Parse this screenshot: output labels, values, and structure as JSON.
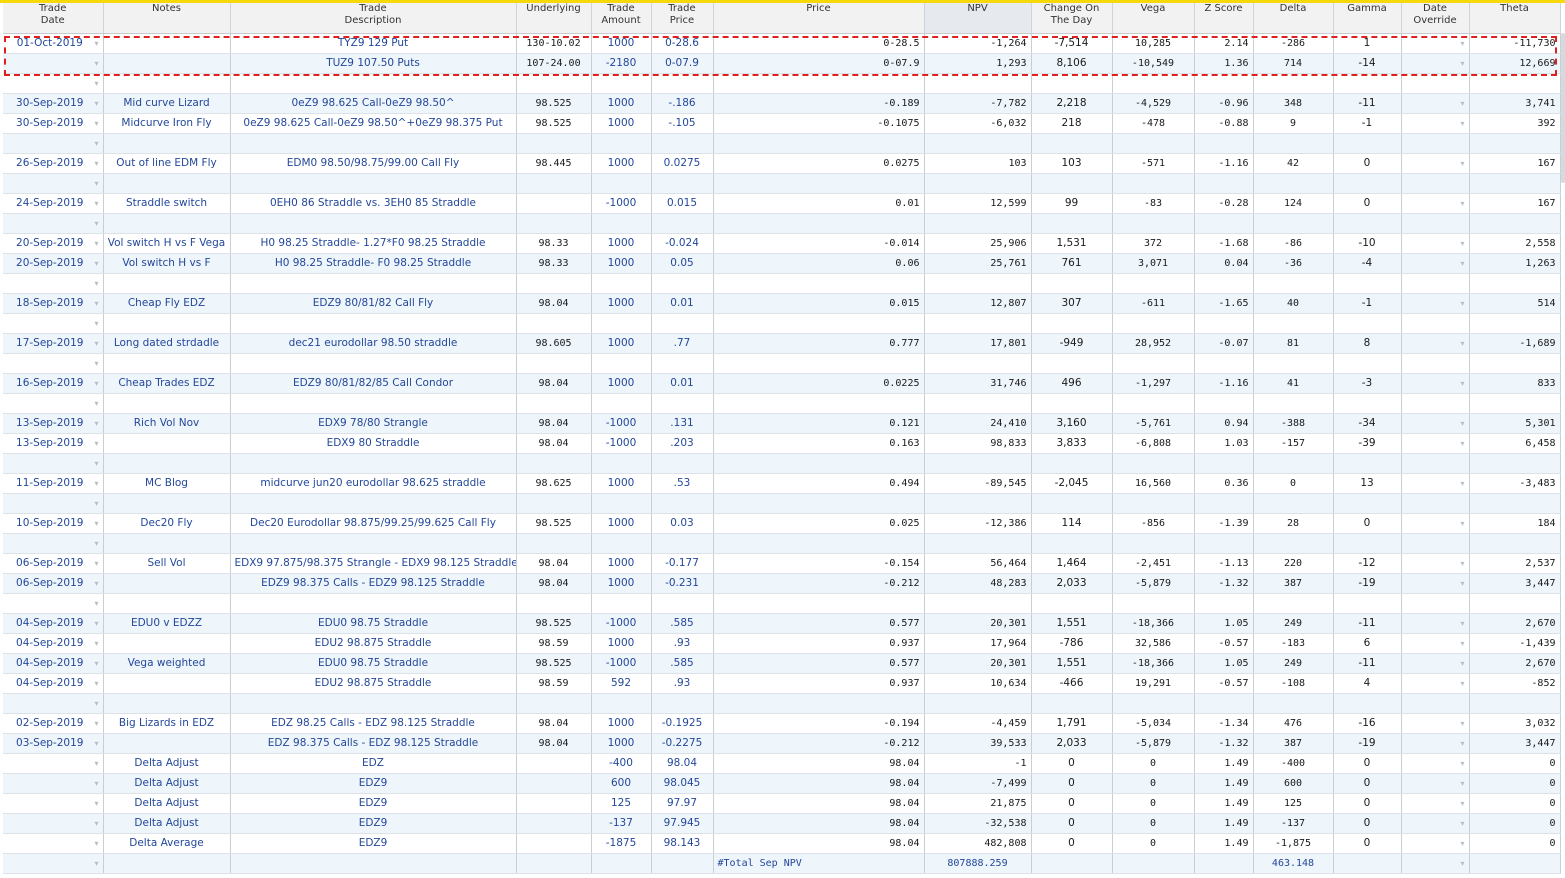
{
  "columns": [
    {
      "key": "trade_date",
      "label": "Trade\nDate"
    },
    {
      "key": "notes",
      "label": "Notes"
    },
    {
      "key": "description",
      "label": "Trade\nDescription"
    },
    {
      "key": "underlying",
      "label": "Underlying"
    },
    {
      "key": "amount",
      "label": "Trade\nAmount"
    },
    {
      "key": "trade_price",
      "label": "Trade\nPrice"
    },
    {
      "key": "price",
      "label": "Price"
    },
    {
      "key": "npv",
      "label": "NPV"
    },
    {
      "key": "change",
      "label": "Change On\nThe Day"
    },
    {
      "key": "vega",
      "label": "Vega"
    },
    {
      "key": "zscore",
      "label": "Z Score"
    },
    {
      "key": "delta",
      "label": "Delta"
    },
    {
      "key": "gamma",
      "label": "Gamma"
    },
    {
      "key": "date_override",
      "label": "Date\nOverride"
    },
    {
      "key": "theta",
      "label": "Theta"
    }
  ],
  "rows": [
    {
      "trade_date": "01-Oct-2019",
      "notes": "",
      "description": "TYZ9 129 Put",
      "underlying": "130-10.02",
      "amount": "1000",
      "trade_price": "0-28.6",
      "price": "0-28.5",
      "npv": "-1,264",
      "change": "-7,514",
      "vega": "10,285",
      "zscore": "2.14",
      "delta": "-286",
      "gamma": "1",
      "date_override": "",
      "theta": "-11,730",
      "style": "highlight"
    },
    {
      "trade_date": "",
      "notes": "",
      "description": "TUZ9 107.50 Puts",
      "underlying": "107-24.00",
      "amount": "-2180",
      "trade_price": "0-07.9",
      "price": "0-07.9",
      "npv": "1,293",
      "change": "8,106",
      "vega": "-10,549",
      "zscore": "1.36",
      "delta": "714",
      "gamma": "-14",
      "date_override": "",
      "theta": "12,669",
      "style": "highlight"
    },
    {
      "spacer": true
    },
    {
      "trade_date": "30-Sep-2019",
      "notes": "Mid curve Lizard",
      "description": "0eZ9 98.625 Call-0eZ9 98.50^",
      "underlying": "98.525",
      "amount": "1000",
      "trade_price": "-.186",
      "price": "-0.189",
      "npv": "-7,782",
      "change": "2,218",
      "vega": "-4,529",
      "zscore": "-0.96",
      "delta": "348",
      "gamma": "-11",
      "date_override": "",
      "theta": "3,741"
    },
    {
      "trade_date": "30-Sep-2019",
      "notes": "Midcurve Iron Fly",
      "description": "0eZ9 98.625 Call-0eZ9 98.50^+0eZ9 98.375 Put",
      "underlying": "98.525",
      "amount": "1000",
      "trade_price": "-.105",
      "price": "-0.1075",
      "npv": "-6,032",
      "change": "218",
      "vega": "-478",
      "zscore": "-0.88",
      "delta": "9",
      "gamma": "-1",
      "date_override": "",
      "theta": "392"
    },
    {
      "spacer": true
    },
    {
      "trade_date": "26-Sep-2019",
      "notes": "Out of line EDM Fly",
      "description": "EDM0 98.50/98.75/99.00 Call Fly",
      "underlying": "98.445",
      "amount": "1000",
      "trade_price": "0.0275",
      "price": "0.0275",
      "npv": "103",
      "change": "103",
      "vega": "-571",
      "zscore": "-1.16",
      "delta": "42",
      "gamma": "0",
      "date_override": "",
      "theta": "167"
    },
    {
      "spacer": true
    },
    {
      "trade_date": "24-Sep-2019",
      "notes": "Straddle switch",
      "description": "0EH0 86 Straddle vs. 3EH0 85 Straddle",
      "underlying": "",
      "amount": "-1000",
      "trade_price": "0.015",
      "price": "0.01",
      "npv": "12,599",
      "change": "99",
      "vega": "-83",
      "zscore": "-0.28",
      "delta": "124",
      "gamma": "0",
      "date_override": "",
      "theta": "167"
    },
    {
      "spacer": true
    },
    {
      "trade_date": "20-Sep-2019",
      "notes": "Vol switch H vs F Vega",
      "description": "H0 98.25 Straddle- 1.27*F0 98.25 Straddle",
      "underlying": "98.33",
      "amount": "1000",
      "trade_price": "-0.024",
      "price": "-0.014",
      "npv": "25,906",
      "change": "1,531",
      "vega": "372",
      "zscore": "-1.68",
      "delta": "-86",
      "gamma": "-10",
      "date_override": "",
      "theta": "2,558"
    },
    {
      "trade_date": "20-Sep-2019",
      "notes": "Vol switch H vs F",
      "description": "H0 98.25 Straddle- F0 98.25 Straddle",
      "underlying": "98.33",
      "amount": "1000",
      "trade_price": "0.05",
      "price": "0.06",
      "npv": "25,761",
      "change": "761",
      "vega": "3,071",
      "zscore": "0.04",
      "delta": "-36",
      "gamma": "-4",
      "date_override": "",
      "theta": "1,263"
    },
    {
      "spacer": true
    },
    {
      "trade_date": "18-Sep-2019",
      "notes": "Cheap Fly EDZ",
      "description": "EDZ9 80/81/82 Call Fly",
      "underlying": "98.04",
      "amount": "1000",
      "trade_price": "0.01",
      "price": "0.015",
      "npv": "12,807",
      "change": "307",
      "vega": "-611",
      "zscore": "-1.65",
      "delta": "40",
      "gamma": "-1",
      "date_override": "",
      "theta": "514"
    },
    {
      "spacer": true
    },
    {
      "trade_date": "17-Sep-2019",
      "notes": "Long dated strdadle",
      "description": "dec21 eurodollar 98.50 straddle",
      "underlying": "98.605",
      "amount": "1000",
      "trade_price": ".77",
      "price": "0.777",
      "npv": "17,801",
      "change": "-949",
      "vega": "28,952",
      "zscore": "-0.07",
      "delta": "81",
      "gamma": "8",
      "date_override": "",
      "theta": "-1,689"
    },
    {
      "spacer": true
    },
    {
      "trade_date": "16-Sep-2019",
      "notes": "Cheap Trades EDZ",
      "description": "EDZ9 80/81/82/85 Call Condor",
      "underlying": "98.04",
      "amount": "1000",
      "trade_price": "0.01",
      "price": "0.0225",
      "npv": "31,746",
      "change": "496",
      "vega": "-1,297",
      "zscore": "-1.16",
      "delta": "41",
      "gamma": "-3",
      "date_override": "",
      "theta": "833"
    },
    {
      "spacer": true
    },
    {
      "trade_date": "13-Sep-2019",
      "notes": "Rich Vol Nov",
      "description": "EDX9 78/80 Strangle",
      "underlying": "98.04",
      "amount": "-1000",
      "trade_price": ".131",
      "price": "0.121",
      "npv": "24,410",
      "change": "3,160",
      "vega": "-5,761",
      "zscore": "0.94",
      "delta": "-388",
      "gamma": "-34",
      "date_override": "",
      "theta": "5,301"
    },
    {
      "trade_date": "13-Sep-2019",
      "notes": "",
      "description": "EDX9 80 Straddle",
      "underlying": "98.04",
      "amount": "-1000",
      "trade_price": ".203",
      "price": "0.163",
      "npv": "98,833",
      "change": "3,833",
      "vega": "-6,808",
      "zscore": "1.03",
      "delta": "-157",
      "gamma": "-39",
      "date_override": "",
      "theta": "6,458"
    },
    {
      "spacer": true
    },
    {
      "trade_date": "11-Sep-2019",
      "notes": "MC Blog",
      "description": "midcurve jun20 eurodollar 98.625 straddle",
      "underlying": "98.625",
      "amount": "1000",
      "trade_price": ".53",
      "price": "0.494",
      "npv": "-89,545",
      "change": "-2,045",
      "vega": "16,560",
      "zscore": "0.36",
      "delta": "0",
      "gamma": "13",
      "date_override": "",
      "theta": "-3,483"
    },
    {
      "spacer": true
    },
    {
      "trade_date": "10-Sep-2019",
      "notes": "Dec20 Fly",
      "description": "Dec20 Eurodollar 98.875/99.25/99.625 Call Fly",
      "underlying": "98.525",
      "amount": "1000",
      "trade_price": "0.03",
      "price": "0.025",
      "npv": "-12,386",
      "change": "114",
      "vega": "-856",
      "zscore": "-1.39",
      "delta": "28",
      "gamma": "0",
      "date_override": "",
      "theta": "184"
    },
    {
      "spacer": true
    },
    {
      "trade_date": "06-Sep-2019",
      "notes": "Sell Vol",
      "description": "EDX9 97.875/98.375 Strangle - EDX9 98.125 Straddle",
      "underlying": "98.04",
      "amount": "1000",
      "trade_price": "-0.177",
      "price": "-0.154",
      "npv": "56,464",
      "change": "1,464",
      "vega": "-2,451",
      "zscore": "-1.13",
      "delta": "220",
      "gamma": "-12",
      "date_override": "",
      "theta": "2,537"
    },
    {
      "trade_date": "06-Sep-2019",
      "notes": "",
      "description": "EDZ9 98.375 Calls - EDZ9 98.125 Straddle",
      "underlying": "98.04",
      "amount": "1000",
      "trade_price": "-0.231",
      "price": "-0.212",
      "npv": "48,283",
      "change": "2,033",
      "vega": "-5,879",
      "zscore": "-1.32",
      "delta": "387",
      "gamma": "-19",
      "date_override": "",
      "theta": "3,447"
    },
    {
      "spacer": true
    },
    {
      "trade_date": "04-Sep-2019",
      "notes": "EDU0 v EDZZ",
      "description": "EDU0 98.75 Straddle",
      "underlying": "98.525",
      "amount": "-1000",
      "trade_price": ".585",
      "price": "0.577",
      "npv": "20,301",
      "change": "1,551",
      "vega": "-18,366",
      "zscore": "1.05",
      "delta": "249",
      "gamma": "-11",
      "date_override": "",
      "theta": "2,670"
    },
    {
      "trade_date": "04-Sep-2019",
      "notes": "",
      "description": "EDU2 98.875 Straddle",
      "underlying": "98.59",
      "amount": "1000",
      "trade_price": ".93",
      "price": "0.937",
      "npv": "17,964",
      "change": "-786",
      "vega": "32,586",
      "zscore": "-0.57",
      "delta": "-183",
      "gamma": "6",
      "date_override": "",
      "theta": "-1,439"
    },
    {
      "trade_date": "04-Sep-2019",
      "notes": "Vega weighted",
      "description": "EDU0 98.75 Straddle",
      "underlying": "98.525",
      "amount": "-1000",
      "trade_price": ".585",
      "price": "0.577",
      "npv": "20,301",
      "change": "1,551",
      "vega": "-18,366",
      "zscore": "1.05",
      "delta": "249",
      "gamma": "-11",
      "date_override": "",
      "theta": "2,670"
    },
    {
      "trade_date": "04-Sep-2019",
      "notes": "",
      "description": "EDU2 98.875 Straddle",
      "underlying": "98.59",
      "amount": "592",
      "trade_price": ".93",
      "price": "0.937",
      "npv": "10,634",
      "change": "-466",
      "vega": "19,291",
      "zscore": "-0.57",
      "delta": "-108",
      "gamma": "4",
      "date_override": "",
      "theta": "-852"
    },
    {
      "spacer": true
    },
    {
      "trade_date": "02-Sep-2019",
      "notes": "Big Lizards in EDZ",
      "description": "EDZ 98.25 Calls - EDZ 98.125 Straddle",
      "underlying": "98.04",
      "amount": "1000",
      "trade_price": "-0.1925",
      "price": "-0.194",
      "npv": "-4,459",
      "change": "1,791",
      "vega": "-5,034",
      "zscore": "-1.34",
      "delta": "476",
      "gamma": "-16",
      "date_override": "",
      "theta": "3,032"
    },
    {
      "trade_date": "03-Sep-2019",
      "notes": "",
      "description": "EDZ 98.375 Calls - EDZ 98.125 Straddle",
      "underlying": "98.04",
      "amount": "1000",
      "trade_price": "-0.2275",
      "price": "-0.212",
      "npv": "39,533",
      "change": "2,033",
      "vega": "-5,879",
      "zscore": "-1.32",
      "delta": "387",
      "gamma": "-19",
      "date_override": "",
      "theta": "3,447"
    },
    {
      "trade_date": "",
      "notes": "Delta Adjust",
      "description": "EDZ",
      "underlying": "",
      "amount": "-400",
      "trade_price": "98.04",
      "price": "98.04",
      "npv": "-1",
      "change": "0",
      "vega": "0",
      "zscore": "1.49",
      "delta": "-400",
      "gamma": "0",
      "date_override": "",
      "theta": "0"
    },
    {
      "trade_date": "",
      "notes": "Delta Adjust",
      "description": "EDZ9",
      "underlying": "",
      "amount": "600",
      "trade_price": "98.045",
      "price": "98.04",
      "npv": "-7,499",
      "change": "0",
      "vega": "0",
      "zscore": "1.49",
      "delta": "600",
      "gamma": "0",
      "date_override": "",
      "theta": "0"
    },
    {
      "trade_date": "",
      "notes": "Delta Adjust",
      "description": "EDZ9",
      "underlying": "",
      "amount": "125",
      "trade_price": "97.97",
      "price": "98.04",
      "npv": "21,875",
      "change": "0",
      "vega": "0",
      "zscore": "1.49",
      "delta": "125",
      "gamma": "0",
      "date_override": "",
      "theta": "0"
    },
    {
      "trade_date": "",
      "notes": "Delta Adjust",
      "description": "EDZ9",
      "underlying": "",
      "amount": "-137",
      "trade_price": "97.945",
      "price": "98.04",
      "npv": "-32,538",
      "change": "0",
      "vega": "0",
      "zscore": "1.49",
      "delta": "-137",
      "gamma": "0",
      "date_override": "",
      "theta": "0"
    },
    {
      "trade_date": "",
      "notes": "Delta Average",
      "description": "EDZ9",
      "underlying": "",
      "amount": "-1875",
      "trade_price": "98.143",
      "price": "98.04",
      "npv": "482,808",
      "change": "0",
      "vega": "0",
      "zscore": "1.49",
      "delta": "-1,875",
      "gamma": "0",
      "date_override": "",
      "theta": "0"
    },
    {
      "trade_date": "",
      "notes": "",
      "description": "",
      "underlying": "",
      "amount": "",
      "trade_price": "",
      "price": "#Total Sep NPV",
      "npv": "807888.259",
      "change": "",
      "vega": "",
      "zscore": "",
      "delta": "463.148",
      "gamma": "",
      "date_override": "",
      "theta": "",
      "style": "total"
    }
  ]
}
